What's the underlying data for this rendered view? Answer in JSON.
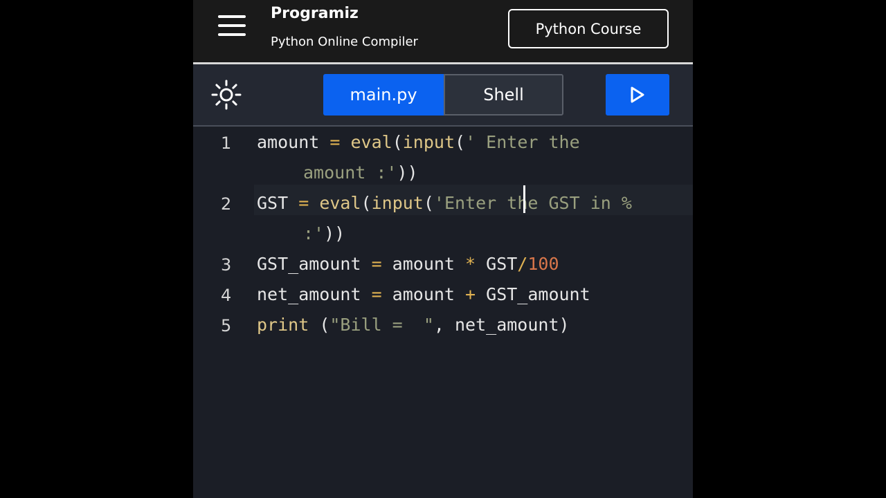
{
  "header": {
    "brand": "Programiz",
    "subtitle": "Python Online Compiler",
    "course_button": "Python Course"
  },
  "toolbar": {
    "tabs": [
      {
        "label": "main.py",
        "active": true
      },
      {
        "label": "Shell",
        "active": false
      }
    ],
    "theme_icon": "sun-icon",
    "run_icon": "play-icon"
  },
  "editor": {
    "line_numbers": [
      "1",
      "2",
      "3",
      "4",
      "5"
    ],
    "lines": {
      "l1a": {
        "var": "amount",
        "op": " = ",
        "fn1": "eval",
        "p1": "(",
        "fn2": "input",
        "p2": "(",
        "str": "' Enter the"
      },
      "l1b": {
        "str": "amount :'",
        "close": "))"
      },
      "l2a": {
        "var": "GST",
        "op": " = ",
        "fn1": "eval",
        "p1": "(",
        "fn2": "input",
        "p2": "(",
        "str": "'Enter the GST in %"
      },
      "l2b": {
        "str": ":'",
        "close": "))"
      },
      "l3": {
        "var1": "GST_amount",
        "op1": " = ",
        "var2": "amount",
        "op2": " * ",
        "var3": "GST",
        "op3": "/",
        "num": "100"
      },
      "l4": {
        "var1": "net_amount",
        "op1": " = ",
        "var2": "amount",
        "op2": " + ",
        "var3": "GST_amount"
      },
      "l5": {
        "fn": "print",
        "p1": " (",
        "str": "\"Bill =  \"",
        "comma": ", ",
        "var": "net_amount",
        "close": ")"
      }
    }
  },
  "colors": {
    "accent": "#0b62f0",
    "background": "#1b1e26",
    "header": "#1a1a1a",
    "operator": "#e0b252",
    "function": "#dfc788",
    "string": "#9aa07f",
    "number": "#d8764a"
  }
}
